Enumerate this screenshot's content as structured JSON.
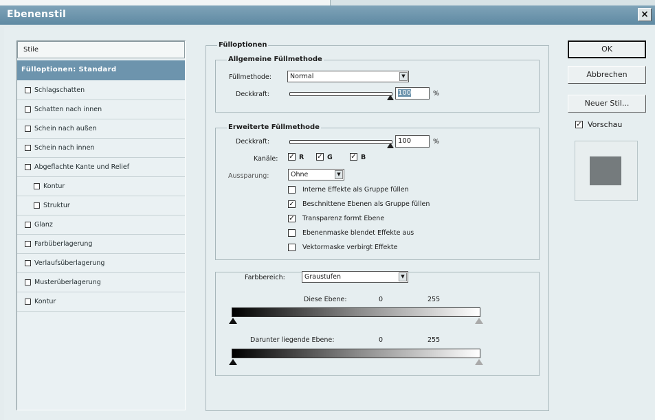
{
  "window": {
    "title": "Ebenenstil",
    "close_label": "×"
  },
  "styles_panel": {
    "header": "Stile",
    "selected_item": "Fülloptionen: Standard",
    "items": [
      {
        "label": "Schlagschatten",
        "checked": false,
        "indent": false
      },
      {
        "label": "Schatten nach innen",
        "checked": false,
        "indent": false
      },
      {
        "label": "Schein nach außen",
        "checked": false,
        "indent": false
      },
      {
        "label": "Schein nach innen",
        "checked": false,
        "indent": false
      },
      {
        "label": "Abgeflachte Kante und Relief",
        "checked": false,
        "indent": false
      },
      {
        "label": "Kontur",
        "checked": false,
        "indent": true
      },
      {
        "label": "Struktur",
        "checked": false,
        "indent": true
      },
      {
        "label": "Glanz",
        "checked": false,
        "indent": false
      },
      {
        "label": "Farbüberlagerung",
        "checked": false,
        "indent": false
      },
      {
        "label": "Verlaufsüberlagerung",
        "checked": false,
        "indent": false
      },
      {
        "label": "Musterüberlagerung",
        "checked": false,
        "indent": false
      },
      {
        "label": "Kontur",
        "checked": false,
        "indent": false
      }
    ]
  },
  "fill_options": {
    "title": "Fülloptionen",
    "general": {
      "title": "Allgemeine Füllmethode",
      "blend_label": "Füllmethode:",
      "blend_value": "Normal",
      "opacity_label": "Deckkraft:",
      "opacity_value": "100",
      "percent": "%"
    },
    "advanced": {
      "title": "Erweiterte Füllmethode",
      "opacity_label": "Deckkraft:",
      "opacity_value": "100",
      "percent": "%",
      "channels_label": "Kanäle:",
      "channels": [
        {
          "label": "R",
          "checked": true
        },
        {
          "label": "G",
          "checked": true
        },
        {
          "label": "B",
          "checked": true
        }
      ],
      "knockout_label": "Aussparung:",
      "knockout_value": "Ohne",
      "options": [
        {
          "label": "Interne Effekte als Gruppe füllen",
          "checked": false
        },
        {
          "label": "Beschnittene Ebenen als Gruppe füllen",
          "checked": true
        },
        {
          "label": "Transparenz formt Ebene",
          "checked": true
        },
        {
          "label": "Ebenenmaske blendet Effekte aus",
          "checked": false
        },
        {
          "label": "Vektormaske verbirgt Effekte",
          "checked": false
        }
      ]
    },
    "blend_if": {
      "color_range_label": "Farbbereich:",
      "color_range_value": "Graustufen",
      "this_layer_label": "Diese Ebene:",
      "this_layer_min": "0",
      "this_layer_max": "255",
      "underlying_label": "Darunter liegende Ebene:",
      "underlying_min": "0",
      "underlying_max": "255"
    }
  },
  "buttons": {
    "ok": "OK",
    "cancel": "Abbrechen",
    "new_style": "Neuer Stil...",
    "preview_label": "Vorschau",
    "preview_checked": true
  },
  "colors": {
    "accent": "#6d94ad",
    "titlebar": "#5f8aa3",
    "preview_swatch": "#757b7d"
  }
}
